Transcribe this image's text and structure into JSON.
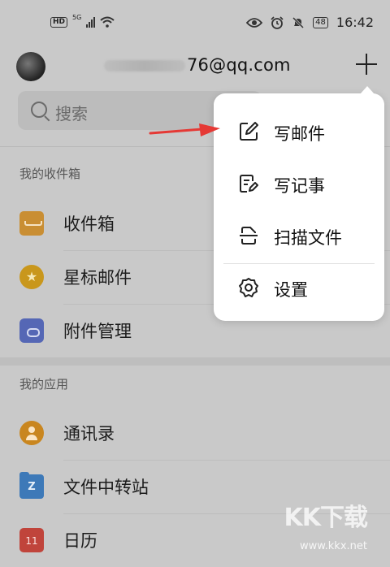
{
  "status": {
    "hd": "HD",
    "net": "5G",
    "battery": "48",
    "time": "16:42"
  },
  "header": {
    "email_suffix": "76@qq.com"
  },
  "search": {
    "placeholder": "搜索"
  },
  "sections": {
    "mailbox_title": "我的收件箱",
    "apps_title": "我的应用"
  },
  "mailbox_items": [
    {
      "label": "收件箱",
      "icon": "inbox-icon"
    },
    {
      "label": "星标邮件",
      "icon": "star-icon"
    },
    {
      "label": "附件管理",
      "icon": "attachment-icon"
    }
  ],
  "app_items": [
    {
      "label": "通讯录",
      "icon": "contacts-icon"
    },
    {
      "label": "文件中转站",
      "icon": "file-transfer-icon",
      "badge": "Z"
    },
    {
      "label": "日历",
      "icon": "calendar-icon",
      "badge": "11"
    }
  ],
  "menu": {
    "items": [
      {
        "label": "写邮件",
        "icon": "compose-icon"
      },
      {
        "label": "写记事",
        "icon": "note-icon"
      },
      {
        "label": "扫描文件",
        "icon": "scan-icon"
      },
      {
        "label": "设置",
        "icon": "settings-icon"
      }
    ]
  },
  "watermark": {
    "logo": "KK下载",
    "url": "www.kkx.net"
  },
  "colors": {
    "annotation_arrow": "#e53935",
    "overlay_bg": "#c9c9c9",
    "menu_bg": "#ffffff"
  }
}
